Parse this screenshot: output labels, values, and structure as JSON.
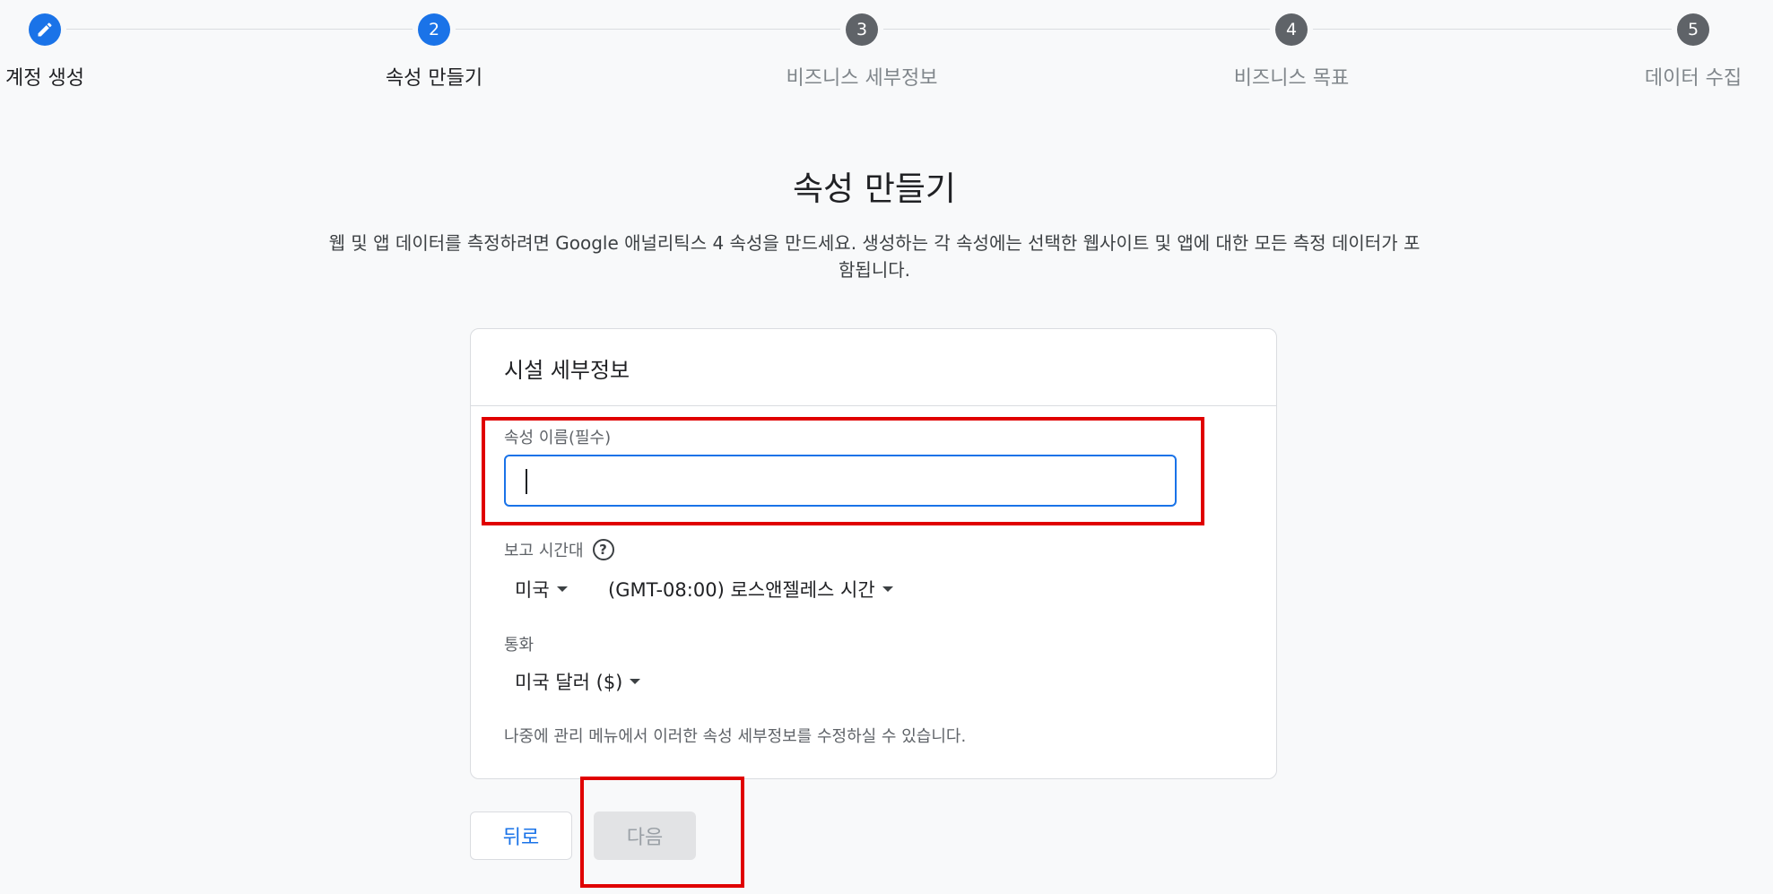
{
  "stepper": {
    "steps": [
      {
        "number": "",
        "icon": "pencil-icon",
        "label": "계정 생성"
      },
      {
        "number": "2",
        "label": "속성 만들기"
      },
      {
        "number": "3",
        "label": "비즈니스 세부정보"
      },
      {
        "number": "4",
        "label": "비즈니스 목표"
      },
      {
        "number": "5",
        "label": "데이터 수집"
      }
    ]
  },
  "page": {
    "title": "속성 만들기",
    "description": "웹 및 앱 데이터를 측정하려면 Google 애널리틱스 4 속성을 만드세요. 생성하는 각 속성에는 선택한 웹사이트 및 앱에 대한 모든 측정 데이터가 포함됩니다."
  },
  "card": {
    "header": "시설 세부정보",
    "property_name": {
      "label": "속성 이름(필수)",
      "value": ""
    },
    "timezone": {
      "label": "보고 시간대",
      "country": "미국",
      "zone": "(GMT-08:00) 로스앤젤레스 시간"
    },
    "currency": {
      "label": "통화",
      "value": "미국 달러 ($)"
    },
    "note": "나중에 관리 메뉴에서 이러한 속성 세부정보를 수정하실 수 있습니다."
  },
  "buttons": {
    "back": "뒤로",
    "next": "다음"
  },
  "colors": {
    "accent": "#1a73e8",
    "highlight": "#e00000",
    "inactive_step": "#5f6368"
  }
}
